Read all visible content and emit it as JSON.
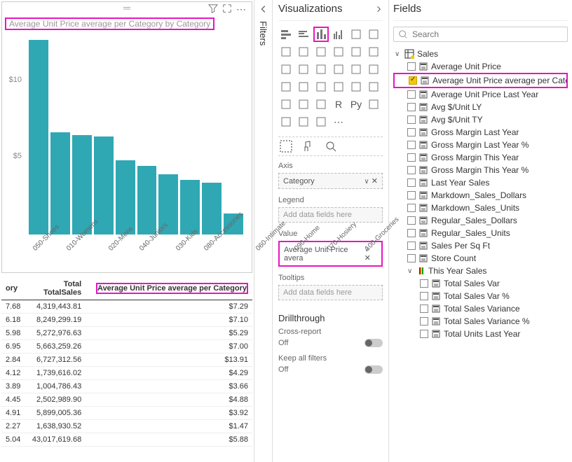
{
  "chart": {
    "title": "Average Unit Price average per Category by Category",
    "yticks": [
      "$10",
      "$5"
    ],
    "chart_data": {
      "type": "bar",
      "categories": [
        "050-Shoes",
        "010-Womens",
        "020-Mens",
        "040-Juniors",
        "030-Kids",
        "080-Accessories",
        "060-Intimate",
        "090-Home",
        "070-Hosiery",
        "100-Groceries"
      ],
      "values": [
        13.9,
        7.3,
        7.1,
        7.0,
        5.3,
        4.9,
        4.3,
        3.9,
        3.7,
        1.5
      ],
      "title": "Average Unit Price average per Category by Category",
      "xlabel": "",
      "ylabel": "",
      "ylim": [
        0,
        14
      ]
    }
  },
  "table": {
    "headers": {
      "cat": "ory",
      "total1": "Total",
      "total1b": "TotalSales",
      "avg": "Average Unit Price average per Category"
    },
    "rows": [
      {
        "cat": "7.68",
        "sales": "4,319,443.81",
        "avg": "$7.29"
      },
      {
        "cat": "6.18",
        "sales": "8,249,299.19",
        "avg": "$7.10"
      },
      {
        "cat": "5.98",
        "sales": "5,272,976.63",
        "avg": "$5.29"
      },
      {
        "cat": "6.95",
        "sales": "5,663,259.26",
        "avg": "$7.00"
      },
      {
        "cat": "2.84",
        "sales": "6,727,312.56",
        "avg": "$13.91"
      },
      {
        "cat": "4.12",
        "sales": "1,739,616.02",
        "avg": "$4.29"
      },
      {
        "cat": "3.89",
        "sales": "1,004,786.43",
        "avg": "$3.66"
      },
      {
        "cat": "4.45",
        "sales": "2,502,989.90",
        "avg": "$4.88"
      },
      {
        "cat": "4.91",
        "sales": "5,899,005.36",
        "avg": "$3.92"
      },
      {
        "cat": "2.27",
        "sales": "1,638,930.52",
        "avg": "$1.47"
      },
      {
        "cat": "5.04",
        "sales": "43,017,619.68",
        "avg": "$5.88"
      }
    ]
  },
  "filters": {
    "label": "Filters"
  },
  "viz": {
    "title": "Visualizations",
    "icons": [
      "stacked-bar",
      "clustered-bar",
      "stacked-col",
      "clustered-col",
      "stacked-bar-100",
      "clustered-col-100",
      "line",
      "area",
      "stacked-area",
      "line-col",
      "line-col2",
      "ribbon",
      "waterfall",
      "funnel",
      "scatter",
      "pie",
      "donut",
      "treemap",
      "map",
      "filled-map",
      "gauge",
      "card",
      "multi-card",
      "kpi",
      "slicer",
      "table",
      "matrix",
      "r",
      "py",
      "key-influencers",
      "decomp",
      "qa",
      "paginated",
      "more"
    ],
    "selected": 2,
    "wells": {
      "axis": {
        "label": "Axis",
        "value": "Category"
      },
      "legend": {
        "label": "Legend",
        "placeholder": "Add data fields here"
      },
      "value": {
        "label": "Value",
        "value": "Average Unit Price avera"
      },
      "tooltips": {
        "label": "Tooltips",
        "placeholder": "Add data fields here"
      }
    },
    "drill": {
      "title": "Drillthrough",
      "cross": "Cross-report",
      "keep": "Keep all filters",
      "off": "Off"
    }
  },
  "fields": {
    "title": "Fields",
    "search_placeholder": "Search",
    "groups": [
      {
        "name": "Sales",
        "expanded": true,
        "items": [
          {
            "name": "Average Unit Price",
            "type": "calc",
            "checked": false
          },
          {
            "name": "Average Unit Price average per Cate...",
            "type": "calc",
            "checked": true,
            "hl": true
          },
          {
            "name": "Average Unit Price Last Year",
            "type": "calc",
            "checked": false
          },
          {
            "name": "Avg $/Unit LY",
            "type": "calc",
            "checked": false
          },
          {
            "name": "Avg $/Unit TY",
            "type": "calc",
            "checked": false
          },
          {
            "name": "Gross Margin Last Year",
            "type": "calc",
            "checked": false
          },
          {
            "name": "Gross Margin Last Year %",
            "type": "calc",
            "checked": false
          },
          {
            "name": "Gross Margin This Year",
            "type": "calc",
            "checked": false
          },
          {
            "name": "Gross Margin This Year %",
            "type": "calc",
            "checked": false
          },
          {
            "name": "Last Year Sales",
            "type": "calc",
            "checked": false
          },
          {
            "name": "Markdown_Sales_Dollars",
            "type": "calc",
            "checked": false
          },
          {
            "name": "Markdown_Sales_Units",
            "type": "calc",
            "checked": false
          },
          {
            "name": "Regular_Sales_Dollars",
            "type": "calc",
            "checked": false
          },
          {
            "name": "Regular_Sales_Units",
            "type": "calc",
            "checked": false
          },
          {
            "name": "Sales Per Sq Ft",
            "type": "calc",
            "checked": false
          },
          {
            "name": "Store Count",
            "type": "calc",
            "checked": false
          }
        ]
      },
      {
        "name": "This Year Sales",
        "expanded": true,
        "nested": true,
        "items": [
          {
            "name": "Total Sales Var",
            "type": "calc",
            "checked": false
          },
          {
            "name": "Total Sales Var %",
            "type": "calc",
            "checked": false
          },
          {
            "name": "Total Sales Variance",
            "type": "calc",
            "checked": false
          },
          {
            "name": "Total Sales Variance %",
            "type": "calc",
            "checked": false
          },
          {
            "name": "Total Units Last Year",
            "type": "calc",
            "checked": false
          }
        ]
      }
    ]
  }
}
